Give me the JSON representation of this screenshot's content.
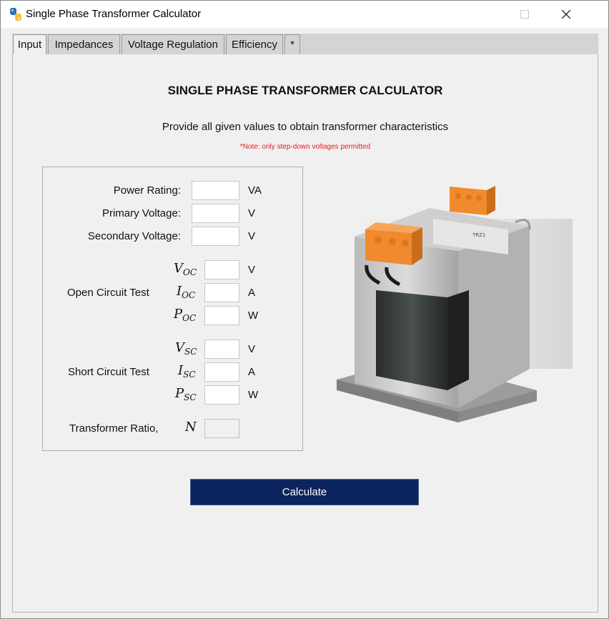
{
  "window": {
    "title": "Single Phase Transformer Calculator",
    "icon": "app-logo-icon"
  },
  "tabs": [
    {
      "label": "Input",
      "active": true
    },
    {
      "label": "Impedances",
      "active": false
    },
    {
      "label": "Voltage Regulation",
      "active": false
    },
    {
      "label": "Efficiency",
      "active": false
    },
    {
      "label": "*",
      "active": false
    }
  ],
  "header": {
    "title": "SINGLE PHASE TRANSFORMER CALCULATOR",
    "subtitle": "Provide all given values to obtain transformer characteristics",
    "note": "*Note: only step-down voltages permitted"
  },
  "form": {
    "power_rating": {
      "label": "Power Rating:",
      "value": "",
      "unit": "VA"
    },
    "primary_voltage": {
      "label": "Primary Voltage:",
      "value": "",
      "unit": "V"
    },
    "secondary_voltage": {
      "label": "Secondary Voltage:",
      "value": "",
      "unit": "V"
    },
    "open_circuit": {
      "label": "Open Circuit Test",
      "voc": {
        "sym": "V",
        "sub": "OC",
        "value": "",
        "unit": "V"
      },
      "ioc": {
        "sym": "I",
        "sub": "OC",
        "value": "",
        "unit": "A"
      },
      "poc": {
        "sym": "P",
        "sub": "OC",
        "value": "",
        "unit": "W"
      }
    },
    "short_circuit": {
      "label": "Short Circuit Test",
      "vsc": {
        "sym": "V",
        "sub": "SC",
        "value": "",
        "unit": "V"
      },
      "isc": {
        "sym": "I",
        "sub": "SC",
        "value": "",
        "unit": "A"
      },
      "psc": {
        "sym": "P",
        "sub": "SC",
        "value": "",
        "unit": "W"
      }
    },
    "ratio": {
      "label": "Transformer Ratio,",
      "sym": "N",
      "value": ""
    }
  },
  "calculate_button": "Calculate",
  "colors": {
    "button_bg": "#0b245e",
    "note_text": "#e02020",
    "terminal_orange": "#f08a2c"
  }
}
